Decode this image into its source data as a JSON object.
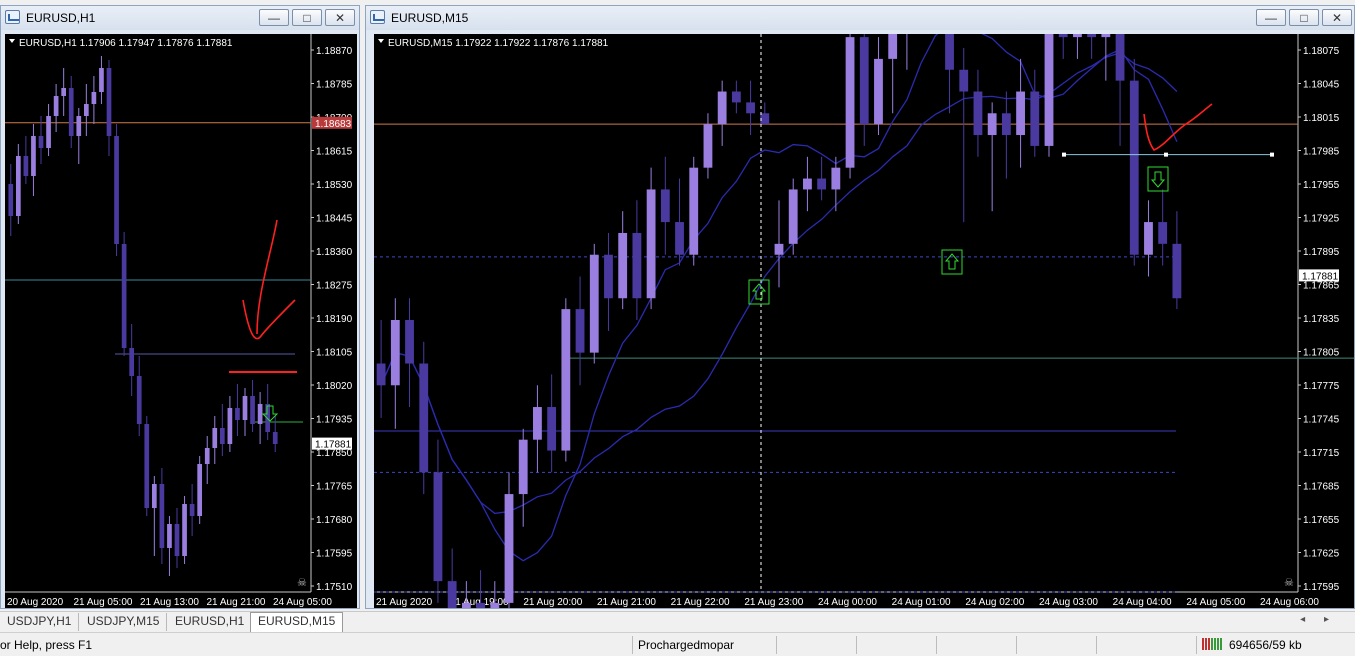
{
  "left_window": {
    "title": "EURUSD,H1",
    "header": "EURUSD,H1  1.17906 1.17947 1.17876 1.17881",
    "price_labels": [
      "1.18870",
      "1.18785",
      "1.18700",
      "1.18615",
      "1.18530",
      "1.18445",
      "1.18360",
      "1.18275",
      "1.18190",
      "1.18105",
      "1.18020",
      "1.17935",
      "1.17850",
      "1.17765",
      "1.17680",
      "1.17595",
      "1.17510"
    ],
    "highlight_price": "1.18683",
    "current_price": "1.17881",
    "time_labels": [
      "20 Aug 2020",
      "21 Aug 05:00",
      "21 Aug 13:00",
      "21 Aug 21:00",
      "24 Aug 05:00"
    ]
  },
  "right_window": {
    "title": "EURUSD,M15",
    "header": "EURUSD,M15  1.17922 1.17922 1.17876 1.17881",
    "price_labels": [
      "1.18075",
      "1.18045",
      "1.18015",
      "1.17985",
      "1.17955",
      "1.17925",
      "1.17895",
      "1.17865",
      "1.17835",
      "1.17805",
      "1.17775",
      "1.17745",
      "1.17715",
      "1.17685",
      "1.17655",
      "1.17625",
      "1.17595"
    ],
    "current_price": "1.17881",
    "time_labels": [
      "21 Aug 2020",
      "21 Aug 19:00",
      "21 Aug 20:00",
      "21 Aug 21:00",
      "21 Aug 22:00",
      "21 Aug 23:00",
      "24 Aug 00:00",
      "24 Aug 01:00",
      "24 Aug 02:00",
      "24 Aug 03:00",
      "24 Aug 04:00",
      "24 Aug 05:00",
      "24 Aug 06:00"
    ]
  },
  "window_buttons": {
    "minimize": "—",
    "maximize": "□",
    "close": "✕"
  },
  "tabs": [
    {
      "label": "USDJPY,H1"
    },
    {
      "label": "USDJPY,M15"
    },
    {
      "label": "EURUSD,H1"
    },
    {
      "label": "EURUSD,M15"
    }
  ],
  "tab_arrows": "◂ ▸",
  "status": {
    "help": "or Help, press F1",
    "profile": "Prochargedmopar",
    "traffic": "694656/59 kb"
  },
  "colors": {
    "bull": "#9b7fe0",
    "bear": "#4a3aa0",
    "ma": "#2b2bb0",
    "resistance": "#d07a4a",
    "annotation": "#ff2020",
    "arrow": "#2fdc2f"
  },
  "chart_data": [
    {
      "type": "candlestick",
      "title": "EURUSD,H1",
      "ylim": [
        1.1751,
        1.1887
      ],
      "ohlc": [
        [
          1.1853,
          1.1858,
          1.184,
          1.1845
        ],
        [
          1.1845,
          1.1863,
          1.1843,
          1.186
        ],
        [
          1.186,
          1.1865,
          1.1853,
          1.1855
        ],
        [
          1.1855,
          1.1868,
          1.185,
          1.1865
        ],
        [
          1.1865,
          1.187,
          1.1858,
          1.1862
        ],
        [
          1.1862,
          1.1873,
          1.186,
          1.187
        ],
        [
          1.187,
          1.1878,
          1.1866,
          1.1875
        ],
        [
          1.1875,
          1.1882,
          1.187,
          1.1877
        ],
        [
          1.1877,
          1.188,
          1.1862,
          1.1865
        ],
        [
          1.1865,
          1.1872,
          1.1858,
          1.187
        ],
        [
          1.187,
          1.1878,
          1.1865,
          1.1873
        ],
        [
          1.1873,
          1.188,
          1.1868,
          1.1876
        ],
        [
          1.1876,
          1.1885,
          1.1873,
          1.1882
        ],
        [
          1.1882,
          1.1884,
          1.186,
          1.1865
        ],
        [
          1.1865,
          1.1868,
          1.1835,
          1.1838
        ],
        [
          1.1838,
          1.1841,
          1.181,
          1.1812
        ],
        [
          1.1812,
          1.1818,
          1.18,
          1.1805
        ],
        [
          1.1805,
          1.181,
          1.179,
          1.1793
        ],
        [
          1.1793,
          1.1795,
          1.177,
          1.1772
        ],
        [
          1.1772,
          1.178,
          1.176,
          1.1778
        ],
        [
          1.1778,
          1.1782,
          1.1758,
          1.1762
        ],
        [
          1.1762,
          1.177,
          1.1755,
          1.1768
        ],
        [
          1.1768,
          1.1772,
          1.1757,
          1.176
        ],
        [
          1.176,
          1.1775,
          1.1758,
          1.1773
        ],
        [
          1.1773,
          1.1778,
          1.1765,
          1.177
        ],
        [
          1.177,
          1.1785,
          1.1768,
          1.1783
        ],
        [
          1.1783,
          1.179,
          1.1778,
          1.1787
        ],
        [
          1.1787,
          1.1795,
          1.1783,
          1.1792
        ],
        [
          1.1792,
          1.1798,
          1.1785,
          1.1788
        ],
        [
          1.1788,
          1.18,
          1.1786,
          1.1797
        ],
        [
          1.1797,
          1.1803,
          1.179,
          1.1794
        ],
        [
          1.1794,
          1.1802,
          1.179,
          1.18
        ],
        [
          1.18,
          1.1804,
          1.1791,
          1.1793
        ],
        [
          1.1793,
          1.1801,
          1.1788,
          1.1798
        ],
        [
          1.1798,
          1.1803,
          1.1789,
          1.1791
        ],
        [
          1.1791,
          1.1795,
          1.1786,
          1.1788
        ]
      ],
      "resistance": 1.18683,
      "levels": [
        1.1829,
        1.18105,
        1.17935
      ],
      "annotation_line": 1.1806,
      "current_price": 1.17881
    },
    {
      "type": "candlestick",
      "title": "EURUSD,M15",
      "ylim": [
        1.1759,
        1.1809
      ],
      "ohlc": [
        [
          1.178,
          1.1784,
          1.1775,
          1.1778
        ],
        [
          1.1778,
          1.1786,
          1.1774,
          1.1784
        ],
        [
          1.1784,
          1.1786,
          1.1776,
          1.178
        ],
        [
          1.178,
          1.1782,
          1.1768,
          1.177
        ],
        [
          1.177,
          1.1773,
          1.1758,
          1.176
        ],
        [
          1.176,
          1.1763,
          1.1753,
          1.1755
        ],
        [
          1.1755,
          1.176,
          1.1752,
          1.1758
        ],
        [
          1.1758,
          1.1761,
          1.175,
          1.1753
        ],
        [
          1.1753,
          1.176,
          1.1752,
          1.1758
        ],
        [
          1.1758,
          1.177,
          1.1756,
          1.1768
        ],
        [
          1.1768,
          1.1774,
          1.1765,
          1.1773
        ],
        [
          1.1773,
          1.1778,
          1.177,
          1.1776
        ],
        [
          1.1776,
          1.1779,
          1.177,
          1.1772
        ],
        [
          1.1772,
          1.1786,
          1.1771,
          1.1785
        ],
        [
          1.1785,
          1.1788,
          1.1778,
          1.1781
        ],
        [
          1.1781,
          1.1791,
          1.178,
          1.179
        ],
        [
          1.179,
          1.1792,
          1.1783,
          1.1786
        ],
        [
          1.1786,
          1.1794,
          1.1785,
          1.1792
        ],
        [
          1.1792,
          1.1795,
          1.1784,
          1.1786
        ],
        [
          1.1786,
          1.1798,
          1.1785,
          1.1796
        ],
        [
          1.1796,
          1.1799,
          1.179,
          1.1793
        ],
        [
          1.1793,
          1.1797,
          1.1789,
          1.179
        ],
        [
          1.179,
          1.1799,
          1.1789,
          1.1798
        ],
        [
          1.1798,
          1.1803,
          1.1797,
          1.1802
        ],
        [
          1.1802,
          1.1806,
          1.18,
          1.1805
        ],
        [
          1.1805,
          1.1806,
          1.1803,
          1.1804
        ],
        [
          1.1804,
          1.1806,
          1.1801,
          1.1803
        ],
        [
          1.1803,
          1.1804,
          1.1802,
          1.1802
        ],
        [
          1.179,
          1.1795,
          1.1787,
          1.1791
        ],
        [
          1.1791,
          1.1797,
          1.179,
          1.1796
        ],
        [
          1.1796,
          1.1799,
          1.1794,
          1.1797
        ],
        [
          1.1797,
          1.1799,
          1.1795,
          1.1796
        ],
        [
          1.1796,
          1.1799,
          1.1794,
          1.1798
        ],
        [
          1.1798,
          1.1813,
          1.1797,
          1.181
        ],
        [
          1.181,
          1.1811,
          1.18,
          1.1802
        ],
        [
          1.1802,
          1.181,
          1.1801,
          1.1808
        ],
        [
          1.1808,
          1.1812,
          1.1803,
          1.1811
        ],
        [
          1.1811,
          1.1813,
          1.1807,
          1.1812
        ],
        [
          1.1812,
          1.1826,
          1.1811,
          1.1824
        ],
        [
          1.1824,
          1.1826,
          1.1815,
          1.1816
        ],
        [
          1.1816,
          1.1818,
          1.1803,
          1.1807
        ],
        [
          1.1807,
          1.1809,
          1.1793,
          1.1805
        ],
        [
          1.1805,
          1.1807,
          1.1799,
          1.1801
        ],
        [
          1.1801,
          1.1804,
          1.1794,
          1.1803
        ],
        [
          1.1803,
          1.1805,
          1.1797,
          1.1801
        ],
        [
          1.1801,
          1.1808,
          1.1798,
          1.1805
        ],
        [
          1.1805,
          1.1807,
          1.1799,
          1.18
        ],
        [
          1.18,
          1.1815,
          1.1799,
          1.1813
        ],
        [
          1.1813,
          1.1815,
          1.1808,
          1.181
        ],
        [
          1.181,
          1.1816,
          1.1808,
          1.1815
        ],
        [
          1.1815,
          1.1817,
          1.1808,
          1.181
        ],
        [
          1.181,
          1.1813,
          1.1806,
          1.1812
        ],
        [
          1.1812,
          1.1814,
          1.18,
          1.1806
        ],
        [
          1.1806,
          1.1808,
          1.1789,
          1.179
        ],
        [
          1.179,
          1.1795,
          1.1788,
          1.1793
        ],
        [
          1.1793,
          1.1796,
          1.1789,
          1.1791
        ],
        [
          1.1791,
          1.1794,
          1.1785,
          1.1786
        ]
      ],
      "resistance": 1.1802,
      "levels": [
        1.17898,
        1.17805,
        1.17738,
        1.177,
        1.1759
      ],
      "trendline": [
        1.17992,
        1.17992
      ],
      "current_price": 1.17881
    }
  ]
}
